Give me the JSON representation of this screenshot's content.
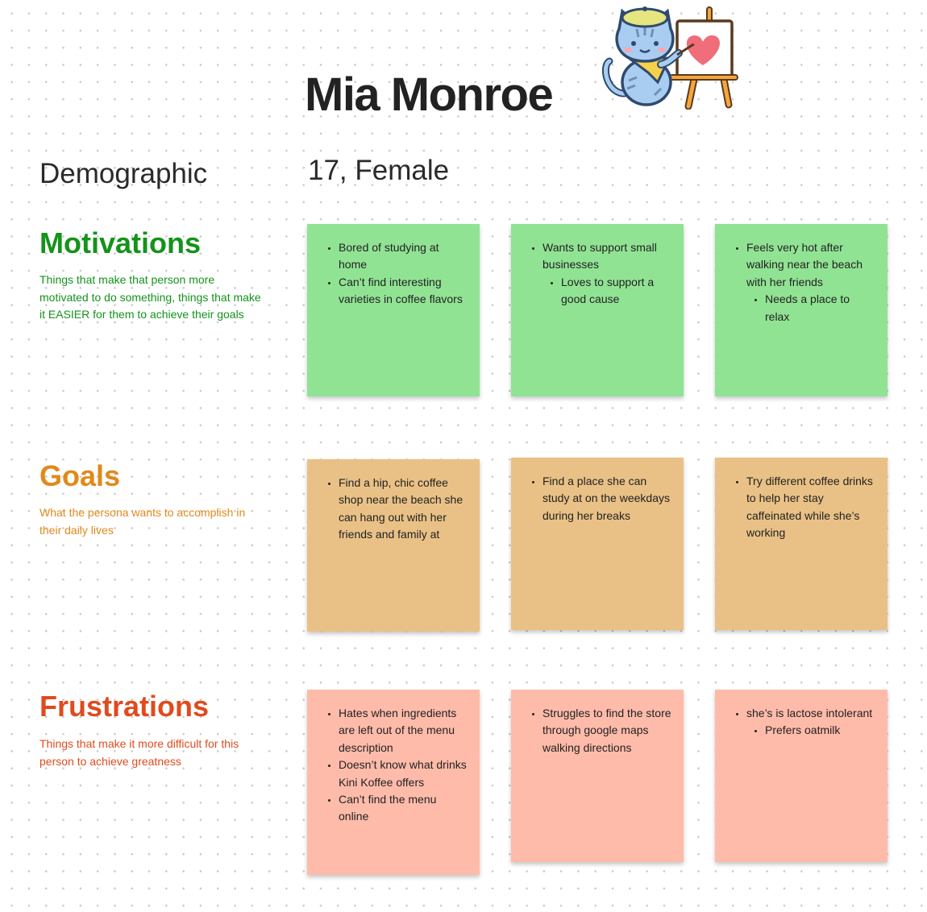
{
  "persona": {
    "name": "Mia Monroe",
    "demographic_label": "Demographic",
    "demographic_value": "17, Female"
  },
  "mascot": {
    "icon": "cat-painter-icon"
  },
  "colors": {
    "motivations": "#14931a",
    "goals": "#e0891a",
    "frustrations": "#df4b1e",
    "note_green": "#91e394",
    "note_orange": "#e9c186",
    "note_pink": "#ffbbaa"
  },
  "sections": {
    "motivations": {
      "title": "Motivations",
      "description": "Things that make that person more motivated to do something, things that make it EASIER for them to achieve their goals",
      "notes": [
        {
          "items": [
            {
              "text": "Bored of studying at home"
            },
            {
              "text": "Can’t find interesting varieties in coffee flavors"
            }
          ]
        },
        {
          "items": [
            {
              "text": "Wants to support small businesses",
              "sub": [
                "Loves to support a good cause"
              ]
            }
          ]
        },
        {
          "items": [
            {
              "text": "Feels very hot after walking near the beach with her friends",
              "sub": [
                "Needs a place to relax"
              ]
            }
          ]
        }
      ]
    },
    "goals": {
      "title": "Goals",
      "description": "What the persona wants to accomplish in their daily lives",
      "notes": [
        {
          "items": [
            {
              "text": "Find a hip, chic coffee shop near the beach she can hang out with her friends and family at"
            }
          ]
        },
        {
          "items": [
            {
              "text": "Find a place she can study at on the weekdays during her breaks"
            }
          ]
        },
        {
          "items": [
            {
              "text": "Try different coffee drinks to help her stay caffeinated while she’s working"
            }
          ]
        }
      ]
    },
    "frustrations": {
      "title": "Frustrations",
      "description": "Things that make it more difficult for this person to achieve greatness",
      "notes": [
        {
          "items": [
            {
              "text": "Hates when ingredients are left out of the menu description"
            },
            {
              "text": "Doesn’t know what drinks Kini Koffee offers"
            },
            {
              "text": "Can’t find the menu online"
            }
          ]
        },
        {
          "items": [
            {
              "text": "Struggles to find the store through google maps walking directions"
            }
          ]
        },
        {
          "items": [
            {
              "text": "she’s is lactose intolerant",
              "sub": [
                "Prefers oatmilk"
              ]
            }
          ]
        }
      ]
    }
  }
}
